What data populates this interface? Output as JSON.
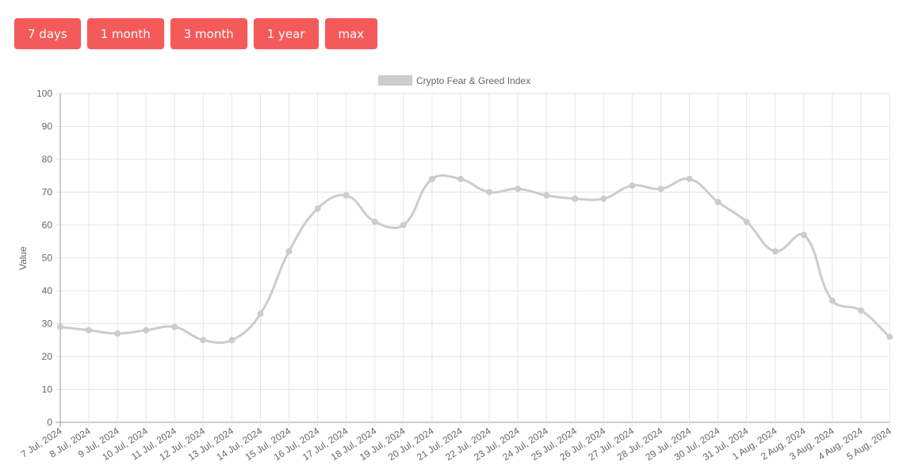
{
  "range_buttons": [
    {
      "label": "7 days"
    },
    {
      "label": "1 month"
    },
    {
      "label": "3 month"
    },
    {
      "label": "1 year"
    },
    {
      "label": "max"
    }
  ],
  "colors": {
    "button": "#f55a5a",
    "series": "#cccccc",
    "grid": "#e5e5e5",
    "axis": "#999999",
    "text": "#666666"
  },
  "chart_data": {
    "type": "line",
    "title": "",
    "xlabel": "",
    "ylabel": "Value",
    "ylim": [
      0,
      100
    ],
    "yticks": [
      0,
      10,
      20,
      30,
      40,
      50,
      60,
      70,
      80,
      90,
      100
    ],
    "grid": true,
    "legend_position": "top",
    "categories": [
      "7 Jul, 2024",
      "8 Jul, 2024",
      "9 Jul, 2024",
      "10 Jul, 2024",
      "11 Jul, 2024",
      "12 Jul, 2024",
      "13 Jul, 2024",
      "14 Jul, 2024",
      "15 Jul, 2024",
      "16 Jul, 2024",
      "17 Jul, 2024",
      "18 Jul, 2024",
      "19 Jul, 2024",
      "20 Jul, 2024",
      "21 Jul, 2024",
      "22 Jul, 2024",
      "23 Jul, 2024",
      "24 Jul, 2024",
      "25 Jul, 2024",
      "26 Jul, 2024",
      "27 Jul, 2024",
      "28 Jul, 2024",
      "29 Jul, 2024",
      "30 Jul, 2024",
      "31 Jul, 2024",
      "1 Aug, 2024",
      "2 Aug, 2024",
      "3 Aug, 2024",
      "4 Aug, 2024",
      "5 Aug, 2024"
    ],
    "series": [
      {
        "name": "Crypto Fear & Greed Index",
        "values": [
          29,
          28,
          27,
          28,
          29,
          25,
          25,
          33,
          52,
          65,
          69,
          61,
          60,
          74,
          74,
          70,
          71,
          69,
          68,
          68,
          72,
          71,
          74,
          67,
          61,
          52,
          57,
          37,
          34,
          26
        ]
      }
    ]
  }
}
